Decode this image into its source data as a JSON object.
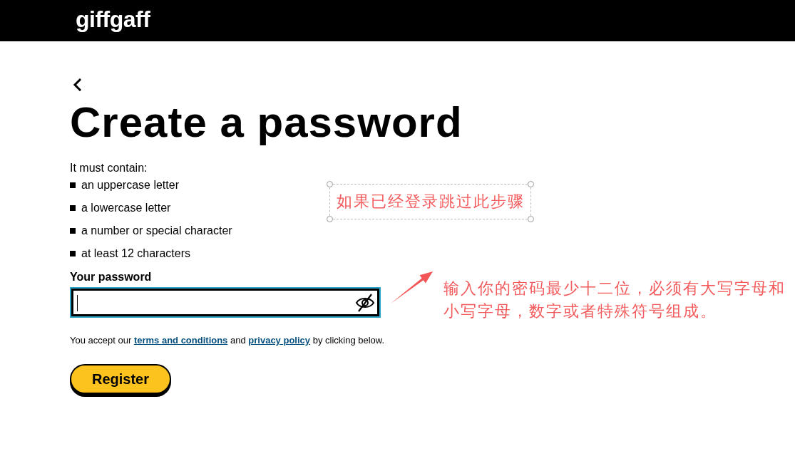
{
  "header": {
    "logo": "giffgaff"
  },
  "title": "Create a password",
  "requirements": {
    "intro": "It must contain:",
    "items": [
      "an uppercase letter",
      "a lowercase letter",
      "a number or special character",
      "at least 12 characters"
    ]
  },
  "password_field": {
    "label": "Your password",
    "focused": true,
    "show_password": false
  },
  "consent": [
    {
      "kind": "text",
      "text": "You accept our"
    },
    {
      "kind": "link",
      "text": "terms and conditions"
    },
    {
      "kind": "text",
      "text": "and"
    },
    {
      "kind": "link",
      "text": "privacy policy"
    },
    {
      "kind": "text",
      "text": "by clicking below."
    }
  ],
  "register_button": "Register",
  "annotations": [
    {
      "kind": "framed_note",
      "text": "如果已经登录跳过此步骤"
    },
    {
      "kind": "arrow_note",
      "text": "输入你的密码最少十二位，必须有大写字母和小写字母，数字或者特殊符号组成。"
    }
  ]
}
